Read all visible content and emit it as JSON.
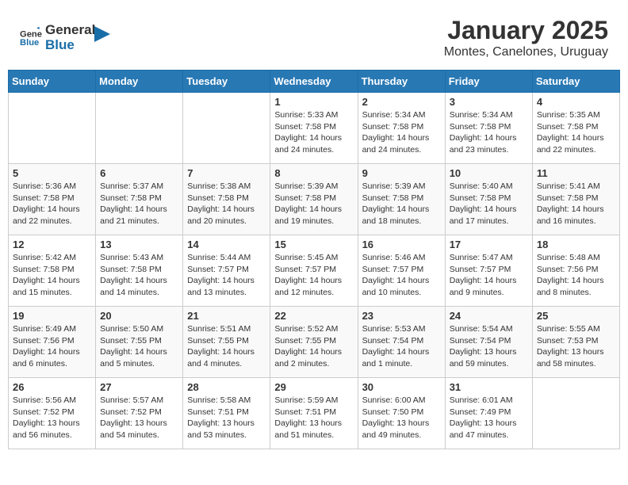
{
  "header": {
    "logo_general": "General",
    "logo_blue": "Blue",
    "month": "January 2025",
    "location": "Montes, Canelones, Uruguay"
  },
  "days_of_week": [
    "Sunday",
    "Monday",
    "Tuesday",
    "Wednesday",
    "Thursday",
    "Friday",
    "Saturday"
  ],
  "weeks": [
    [
      {
        "day": "",
        "info": ""
      },
      {
        "day": "",
        "info": ""
      },
      {
        "day": "",
        "info": ""
      },
      {
        "day": "1",
        "info": "Sunrise: 5:33 AM\nSunset: 7:58 PM\nDaylight: 14 hours and 24 minutes."
      },
      {
        "day": "2",
        "info": "Sunrise: 5:34 AM\nSunset: 7:58 PM\nDaylight: 14 hours and 24 minutes."
      },
      {
        "day": "3",
        "info": "Sunrise: 5:34 AM\nSunset: 7:58 PM\nDaylight: 14 hours and 23 minutes."
      },
      {
        "day": "4",
        "info": "Sunrise: 5:35 AM\nSunset: 7:58 PM\nDaylight: 14 hours and 22 minutes."
      }
    ],
    [
      {
        "day": "5",
        "info": "Sunrise: 5:36 AM\nSunset: 7:58 PM\nDaylight: 14 hours and 22 minutes."
      },
      {
        "day": "6",
        "info": "Sunrise: 5:37 AM\nSunset: 7:58 PM\nDaylight: 14 hours and 21 minutes."
      },
      {
        "day": "7",
        "info": "Sunrise: 5:38 AM\nSunset: 7:58 PM\nDaylight: 14 hours and 20 minutes."
      },
      {
        "day": "8",
        "info": "Sunrise: 5:39 AM\nSunset: 7:58 PM\nDaylight: 14 hours and 19 minutes."
      },
      {
        "day": "9",
        "info": "Sunrise: 5:39 AM\nSunset: 7:58 PM\nDaylight: 14 hours and 18 minutes."
      },
      {
        "day": "10",
        "info": "Sunrise: 5:40 AM\nSunset: 7:58 PM\nDaylight: 14 hours and 17 minutes."
      },
      {
        "day": "11",
        "info": "Sunrise: 5:41 AM\nSunset: 7:58 PM\nDaylight: 14 hours and 16 minutes."
      }
    ],
    [
      {
        "day": "12",
        "info": "Sunrise: 5:42 AM\nSunset: 7:58 PM\nDaylight: 14 hours and 15 minutes."
      },
      {
        "day": "13",
        "info": "Sunrise: 5:43 AM\nSunset: 7:58 PM\nDaylight: 14 hours and 14 minutes."
      },
      {
        "day": "14",
        "info": "Sunrise: 5:44 AM\nSunset: 7:57 PM\nDaylight: 14 hours and 13 minutes."
      },
      {
        "day": "15",
        "info": "Sunrise: 5:45 AM\nSunset: 7:57 PM\nDaylight: 14 hours and 12 minutes."
      },
      {
        "day": "16",
        "info": "Sunrise: 5:46 AM\nSunset: 7:57 PM\nDaylight: 14 hours and 10 minutes."
      },
      {
        "day": "17",
        "info": "Sunrise: 5:47 AM\nSunset: 7:57 PM\nDaylight: 14 hours and 9 minutes."
      },
      {
        "day": "18",
        "info": "Sunrise: 5:48 AM\nSunset: 7:56 PM\nDaylight: 14 hours and 8 minutes."
      }
    ],
    [
      {
        "day": "19",
        "info": "Sunrise: 5:49 AM\nSunset: 7:56 PM\nDaylight: 14 hours and 6 minutes."
      },
      {
        "day": "20",
        "info": "Sunrise: 5:50 AM\nSunset: 7:55 PM\nDaylight: 14 hours and 5 minutes."
      },
      {
        "day": "21",
        "info": "Sunrise: 5:51 AM\nSunset: 7:55 PM\nDaylight: 14 hours and 4 minutes."
      },
      {
        "day": "22",
        "info": "Sunrise: 5:52 AM\nSunset: 7:55 PM\nDaylight: 14 hours and 2 minutes."
      },
      {
        "day": "23",
        "info": "Sunrise: 5:53 AM\nSunset: 7:54 PM\nDaylight: 14 hours and 1 minute."
      },
      {
        "day": "24",
        "info": "Sunrise: 5:54 AM\nSunset: 7:54 PM\nDaylight: 13 hours and 59 minutes."
      },
      {
        "day": "25",
        "info": "Sunrise: 5:55 AM\nSunset: 7:53 PM\nDaylight: 13 hours and 58 minutes."
      }
    ],
    [
      {
        "day": "26",
        "info": "Sunrise: 5:56 AM\nSunset: 7:52 PM\nDaylight: 13 hours and 56 minutes."
      },
      {
        "day": "27",
        "info": "Sunrise: 5:57 AM\nSunset: 7:52 PM\nDaylight: 13 hours and 54 minutes."
      },
      {
        "day": "28",
        "info": "Sunrise: 5:58 AM\nSunset: 7:51 PM\nDaylight: 13 hours and 53 minutes."
      },
      {
        "day": "29",
        "info": "Sunrise: 5:59 AM\nSunset: 7:51 PM\nDaylight: 13 hours and 51 minutes."
      },
      {
        "day": "30",
        "info": "Sunrise: 6:00 AM\nSunset: 7:50 PM\nDaylight: 13 hours and 49 minutes."
      },
      {
        "day": "31",
        "info": "Sunrise: 6:01 AM\nSunset: 7:49 PM\nDaylight: 13 hours and 47 minutes."
      },
      {
        "day": "",
        "info": ""
      }
    ]
  ]
}
